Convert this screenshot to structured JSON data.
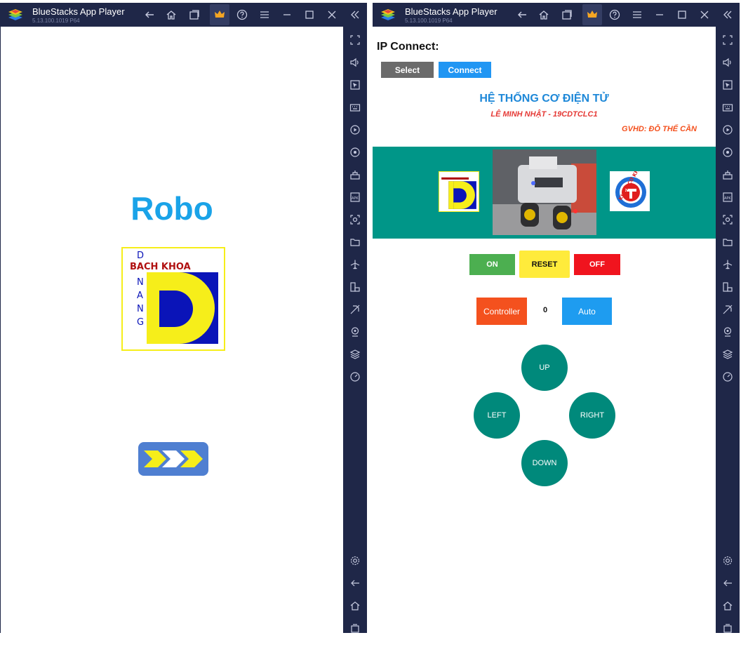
{
  "left_window": {
    "title": "BlueStacks App Player",
    "version": "5.13.100.1019 P64",
    "app": {
      "title": "Robo",
      "logo": {
        "lines": [
          "D",
          "BACH KHOA",
          "N",
          "A",
          "N",
          "G"
        ]
      }
    }
  },
  "right_window": {
    "title": "BlueStacks App Player",
    "version": "5.13.100.1019 P64",
    "app": {
      "ip_label": "IP Connect:",
      "select_label": "Select",
      "connect_label": "Connect",
      "heading": "HỆ THỐNG CƠ ĐIỆN TỬ",
      "author": "LÊ MINH NHẬT - 19CDTCLC1",
      "advisor": "GVHD: ĐỖ THẾ CẦN",
      "right_logo_text": "KHOA CƠ KHÍ",
      "on_label": "ON",
      "reset_label": "RESET",
      "off_label": "OFF",
      "controller_label": "Controller",
      "counter_value": "0",
      "auto_label": "Auto",
      "up_label": "UP",
      "left_label": "LEFT",
      "right_label": "RIGHT",
      "down_label": "DOWN"
    }
  },
  "titlebar_icons": [
    "back-icon",
    "home-icon",
    "multi-instance-icon",
    "crown-icon",
    "help-icon",
    "menu-icon",
    "minimize-icon",
    "maximize-icon",
    "close-icon",
    "collapse-sidebar-icon"
  ],
  "sidebar_icons": [
    "fullscreen-icon",
    "volume-icon",
    "cursor-icon",
    "keyboard-icon",
    "macro-play-icon",
    "record-icon",
    "apk-build-icon",
    "apk-install-icon",
    "screenshot-icon",
    "folder-icon",
    "airplane-icon",
    "resize-icon",
    "eco-mode-icon",
    "location-icon",
    "layers-icon",
    "performance-icon",
    "settings-icon",
    "back-icon",
    "home-icon",
    "recent-apps-icon"
  ],
  "colors": {
    "chrome": "#1f2748",
    "teal": "#009688",
    "accent_blue": "#1aa3e8",
    "green": "#4caf50",
    "yellow": "#ffeb3b",
    "red": "#f0141e",
    "orange": "#f4511e"
  }
}
